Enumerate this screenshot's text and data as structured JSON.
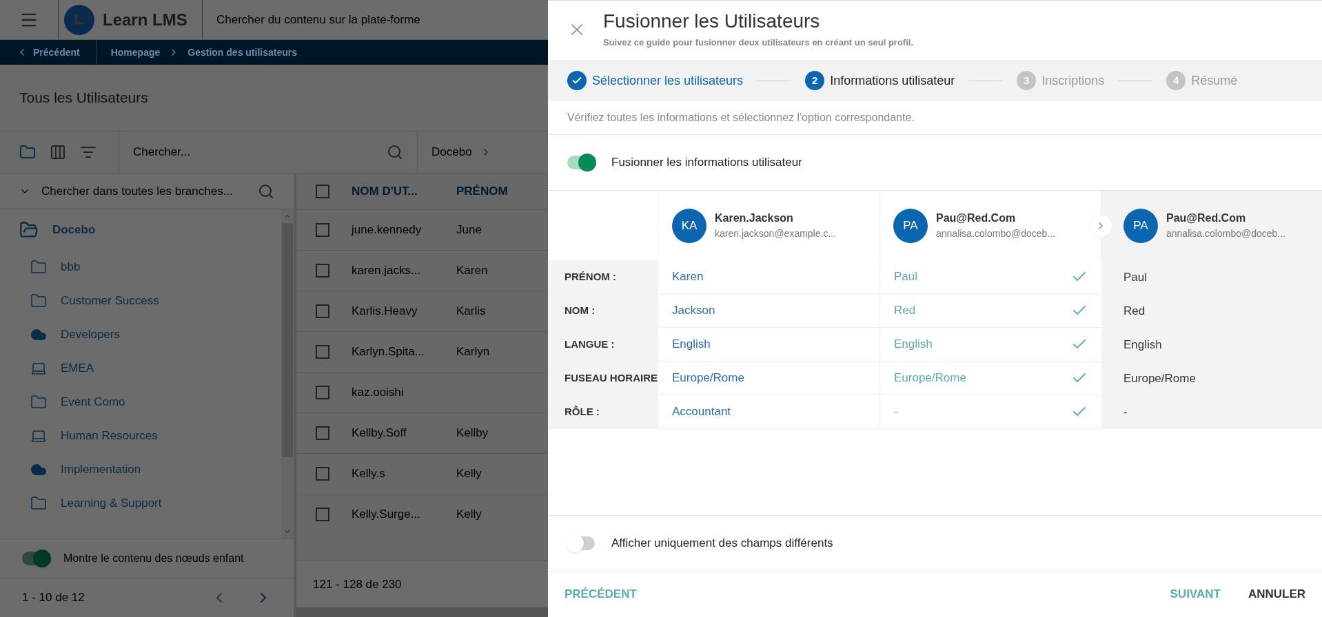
{
  "topbar": {
    "logo_text": "Learn LMS",
    "search_placeholder": "Chercher du contenu sur la plate-forme"
  },
  "breadcrumb": {
    "back": "Précédent",
    "items": [
      "Homepage",
      "Gestion des utilisateurs"
    ]
  },
  "page_title": "Tous les Utilisateurs",
  "toolbar": {
    "search_placeholder": "Chercher...",
    "branch": "Docebo"
  },
  "tree": {
    "search_placeholder": "Chercher dans toutes les branches...",
    "root": {
      "label": "Docebo",
      "expanded": true,
      "children": [
        {
          "label": "bbb",
          "kind": "folder"
        },
        {
          "label": "Customer Success",
          "kind": "folder"
        },
        {
          "label": "Developers",
          "kind": "cloud"
        },
        {
          "label": "EMEA",
          "kind": "laptop"
        },
        {
          "label": "Event Como",
          "kind": "folder"
        },
        {
          "label": "Human Resources",
          "kind": "laptop"
        },
        {
          "label": "Implementation",
          "kind": "cloud"
        },
        {
          "label": "Learning & Support",
          "kind": "folder"
        }
      ]
    },
    "toggle": {
      "label": "Montre le contenu des nœuds enfant",
      "on": true
    },
    "pagination": "1 - 10 de 12"
  },
  "table": {
    "header_checked": false,
    "columns": [
      "NOM D'UT...",
      "PRÉNOM"
    ],
    "rows": [
      {
        "username": "june.kennedy",
        "first_name": "June",
        "checked": false
      },
      {
        "username": "karen.jacks...",
        "first_name": "Karen",
        "checked": false
      },
      {
        "username": "Karlis.Heavy",
        "first_name": "Karlis",
        "checked": false
      },
      {
        "username": "Karlyn.Spita...",
        "first_name": "Karlyn",
        "checked": false
      },
      {
        "username": "kaz.ooishi",
        "checked": false
      },
      {
        "username": "Kellby.Soff",
        "first_name": "Kellby",
        "checked": false
      },
      {
        "username": "Kelly.s",
        "first_name": "Kelly",
        "checked": false
      },
      {
        "username": "Kelly.Surge...",
        "first_name": "Kelly",
        "checked": false
      }
    ],
    "footer": "121 - 128 de 230"
  },
  "dialog": {
    "title": "Fusionner les Utilisateurs",
    "subtitle": "Suivez ce guide pour fusionner deux utilisateurs en créant un seul profil.",
    "steps": [
      {
        "label": "Sélectionner les utilisateurs",
        "completed": true,
        "selected": false
      },
      {
        "number": "2",
        "label": "Informations utilisateur",
        "completed": false,
        "selected": true
      },
      {
        "number": "3",
        "label": "Inscriptions",
        "completed": false,
        "selected": false
      },
      {
        "number": "4",
        "label": "Résumé",
        "completed": false,
        "selected": false
      }
    ],
    "hint": "Vérifiez toutes les informations et sélectionnez l'option correspondante.",
    "merge_toggle": {
      "label": "Fusionner les informations utilisateur",
      "on": true
    },
    "users": [
      {
        "initials": "KA",
        "name": "Karen.Jackson",
        "email": "karen.jackson@example.c..."
      },
      {
        "initials": "PA",
        "name": "Pau@Red.Com",
        "email": "annalisa.colombo@doceb..."
      }
    ],
    "result": {
      "initials": "PA",
      "name": "Pau@Red.Com",
      "email": "annalisa.colombo@doceb..."
    },
    "fields": [
      {
        "label": "PRÉNOM :",
        "first": "Karen",
        "second": "Paul",
        "second_selected": true,
        "result": "Paul"
      },
      {
        "label": "NOM :",
        "first": "Jackson",
        "second": "Red",
        "second_selected": true,
        "result": "Red"
      },
      {
        "label": "LANGUE :",
        "first": "English",
        "second": "English",
        "second_selected": true,
        "result": "English"
      },
      {
        "label": "FUSEAU HORAIRE",
        "first": "Europe/Rome",
        "second": "Europe/Rome",
        "second_selected": true,
        "result": "Europe/Rome"
      },
      {
        "label": "RÔLE :",
        "first": "Accountant",
        "second": "-",
        "second_selected": true,
        "result": "-"
      }
    ],
    "diff_toggle": {
      "label": "Afficher uniquement des champs différents",
      "on": false
    },
    "buttons": {
      "back": "PRÉCÉDENT",
      "next": "SUIVANT",
      "cancel": "ANNULER"
    }
  }
}
